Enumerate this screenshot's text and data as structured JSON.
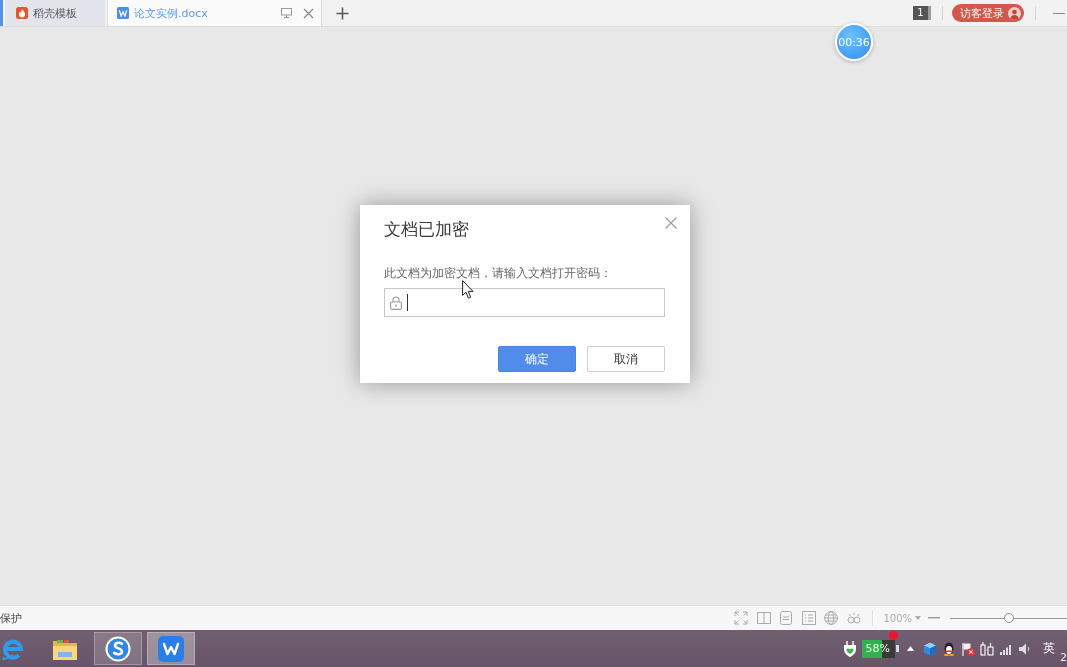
{
  "tabs": [
    {
      "label": "稻壳模板",
      "kind": "template",
      "selected": false
    },
    {
      "label": "论文实例.docx",
      "kind": "document",
      "selected": true
    }
  ],
  "header": {
    "window_count": "1",
    "login_button": "访客登录"
  },
  "timer": "00:36",
  "dialog": {
    "title": "文档已加密",
    "message": "此文档为加密文档，请输入文档打开密码：",
    "password_field": {
      "focused": true
    },
    "buttons": [
      {
        "label": "确定",
        "kind": "primary"
      },
      {
        "label": "取消",
        "kind": "secondary"
      }
    ]
  },
  "status_bar": {
    "text": "保护",
    "zoom": "100%",
    "zoom_slider": {
      "level": 0.5
    }
  },
  "taskbar": {
    "apps": [
      {
        "kind": "e-logo",
        "running": false,
        "selected": false
      },
      {
        "kind": "folder",
        "running": false,
        "selected": false
      },
      {
        "kind": "s-logo",
        "running": true,
        "selected": false
      },
      {
        "kind": "w-logo",
        "running": true,
        "selected": true
      }
    ],
    "battery": "58%",
    "input_method": "英",
    "clock": "2"
  }
}
